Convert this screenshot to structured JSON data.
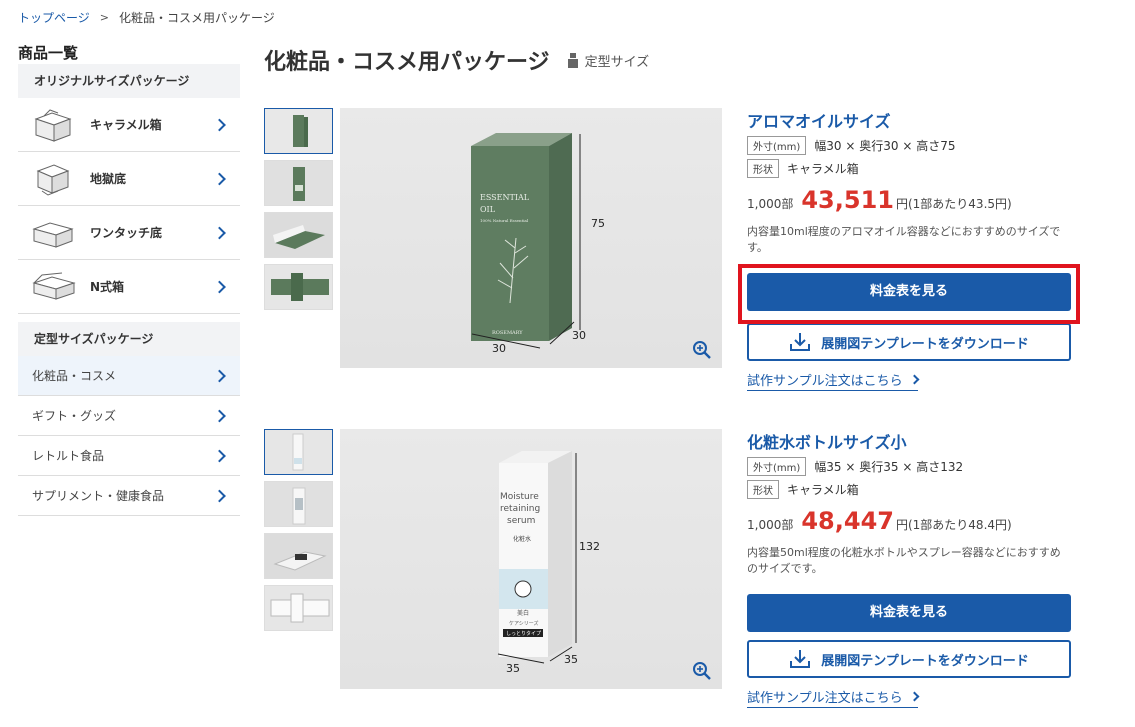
{
  "breadcrumb": {
    "home": "トップページ",
    "current": "化粧品・コスメ用パッケージ"
  },
  "sidebar": {
    "title": "商品一覧",
    "section1": "オリジナルサイズパッケージ",
    "items1": [
      {
        "label": "キャラメル箱"
      },
      {
        "label": "地獄底"
      },
      {
        "label": "ワンタッチ底"
      },
      {
        "label": "N式箱"
      }
    ],
    "section2": "定型サイズパッケージ",
    "items2": [
      {
        "label": "化粧品・コスメ"
      },
      {
        "label": "ギフト・グッズ"
      },
      {
        "label": "レトルト食品"
      },
      {
        "label": "サプリメント・健康食品"
      }
    ]
  },
  "page": {
    "title": "化粧品・コスメ用パッケージ",
    "tag": "定型サイズ"
  },
  "products": [
    {
      "name": "アロマオイルサイズ",
      "spec_key": "外寸(mm)",
      "spec_val": "幅30 × 奥行30 × 高さ75",
      "shape_key": "形状",
      "shape_val": "キャラメル箱",
      "qty": "1,000部",
      "price": "43,511",
      "unit": "円(1部あたり43.5円)",
      "desc": "内容量10ml程度のアロマオイル容器などにおすすめのサイズです。",
      "btn_price": "料金表を見る",
      "btn_download": "展開図テンプレートをダウンロード",
      "sample": "試作サンプル注文はこちら",
      "dim_h": "75",
      "dim_w": "30",
      "dim_d": "30",
      "box_text": [
        "ESSENTIAL",
        "OIL",
        "100% Natural Essential",
        "ROSEMARY"
      ]
    },
    {
      "name": "化粧水ボトルサイズ小",
      "spec_key": "外寸(mm)",
      "spec_val": "幅35 × 奥行35 × 高さ132",
      "shape_key": "形状",
      "shape_val": "キャラメル箱",
      "qty": "1,000部",
      "price": "48,447",
      "unit": "円(1部あたり48.4円)",
      "desc": "内容量50ml程度の化粧水ボトルやスプレー容器などにおすすめのサイズです。",
      "btn_price": "料金表を見る",
      "btn_download": "展開図テンプレートをダウンロード",
      "sample": "試作サンプル注文はこちら",
      "dim_h": "132",
      "dim_w": "35",
      "dim_d": "35",
      "box_text": [
        "Moisture",
        "retaining",
        "serum",
        "化粧水",
        "美白",
        "ケアシリーズ",
        "しっとりタイプ"
      ]
    }
  ],
  "colors": {
    "accent": "#1a5aa8",
    "price": "#d9342b",
    "highlight": "#e0141e"
  }
}
